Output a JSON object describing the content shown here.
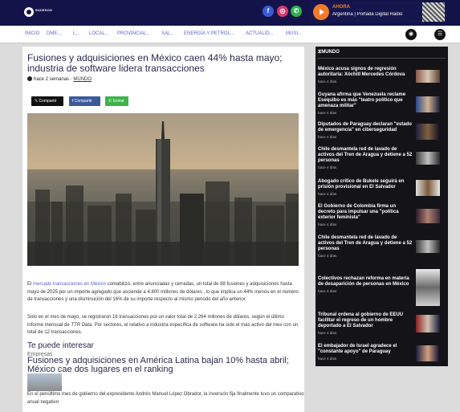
{
  "brand": {
    "logo_text": "SUCESOS"
  },
  "social": {
    "facebook": "f",
    "instagram": "◎",
    "whatsapp": "✆"
  },
  "radio": {
    "now_label": "AHORA",
    "title": "Argentina | Portada Digital Radio"
  },
  "nav": {
    "items": [
      "INICIO",
      "DME...",
      "L...",
      "LOCAL...",
      "PROVINCIAL...",
      "SAL...",
      "ENERGÍA Y PETROL...",
      "ACTUALID...",
      "MUSI..."
    ],
    "radio_icon": "headphones-icon",
    "menu_icon": "hamburger-icon"
  },
  "article": {
    "title": "Fusiones y adquisiciones en México caen 44% hasta mayo; industria de software lidera transacciones",
    "time_ago": "hace 2 semanas",
    "separator": "·",
    "category": "MUNDO",
    "share": {
      "x": "Compartir",
      "facebook": "Compartir",
      "whatsapp": "Enviar"
    },
    "p1_pre": "El ",
    "p1_link": "mercado transacciones en México",
    "p1_post": " contabilizó, entre anunciadas y cerradas, un total de 88 fusiones y adquisiciones hasta mayo de 2025 por un importe agregado que asciende a 4,800 millones de dólares , lo que implica un 44% menos en el número de transacciones y una disminución del 16% de su importe respecto al mismo periodo del año anterior.",
    "p2_pre": "Solo en el mes de mayo, se registraron 16 transacciones por un valor total de 2,264 millones de dólares, según el último informe mensual de ",
    "p2_italic": "TTR Data",
    "p2_post": ". Por sectores, el relativo a industria específica de software ha sido el más activo del mes con un total de 12 transacciones."
  },
  "related": {
    "heading": "Te puede interesar",
    "category": "Empresas",
    "title": "Fusiones y adquisiciones en América Latina bajan 10% hasta abril; México cae dos lugares en el ranking",
    "excerpt": "En el penúltimo mes de gobierno del expresidente Andrés Manuel López Obrador, la inversión fija finalmente tuvo un comparativo anual negativo"
  },
  "sidebar": {
    "heading": "MUNDO",
    "items": [
      {
        "title": "México acusa signos de regresión autoritaria: Xóchitl Mercedes Córdova",
        "meta": "hace 4 días"
      },
      {
        "title": "Guyana afirma que Venezuela reclame Esequibo es más \"teatro político que amenaza militar\"",
        "meta": "hace 4 días"
      },
      {
        "title": "Diputados de Paraguay declaran \"estado de emergencia\" en ciberseguridad",
        "meta": "hace 4 días"
      },
      {
        "title": "Chile desmantela red de lavado de activos del Tren de Aragua y detiene a 52 personas",
        "meta": "hace 4 días"
      },
      {
        "title": "Abogado crítico de Bukele seguirá en prisión provisional en El Salvador",
        "meta": "hace 4 días"
      },
      {
        "title": "El Gobierno de Colombia firma un decreto para impulsar una \"política exterior feminista\"",
        "meta": "hace 4 días"
      },
      {
        "title": "Chile desmantela red de lavado de activos del Tren de Aragua y detiene a 52 personas",
        "meta": "hace 4 días"
      },
      {
        "title": "Colectivos rechazan reforma en materia de desaparición de personas en México",
        "meta": "hace 4 días"
      },
      {
        "title": "Tribunal ordena al gobierno de EEUU facilitar el regreso de un hombre deportado a El Salvador",
        "meta": "hace 4 días"
      },
      {
        "title": "El embajador de Israel agradece el \"constante apoyo\" de Paraguay",
        "meta": "hace 4 días"
      }
    ]
  }
}
